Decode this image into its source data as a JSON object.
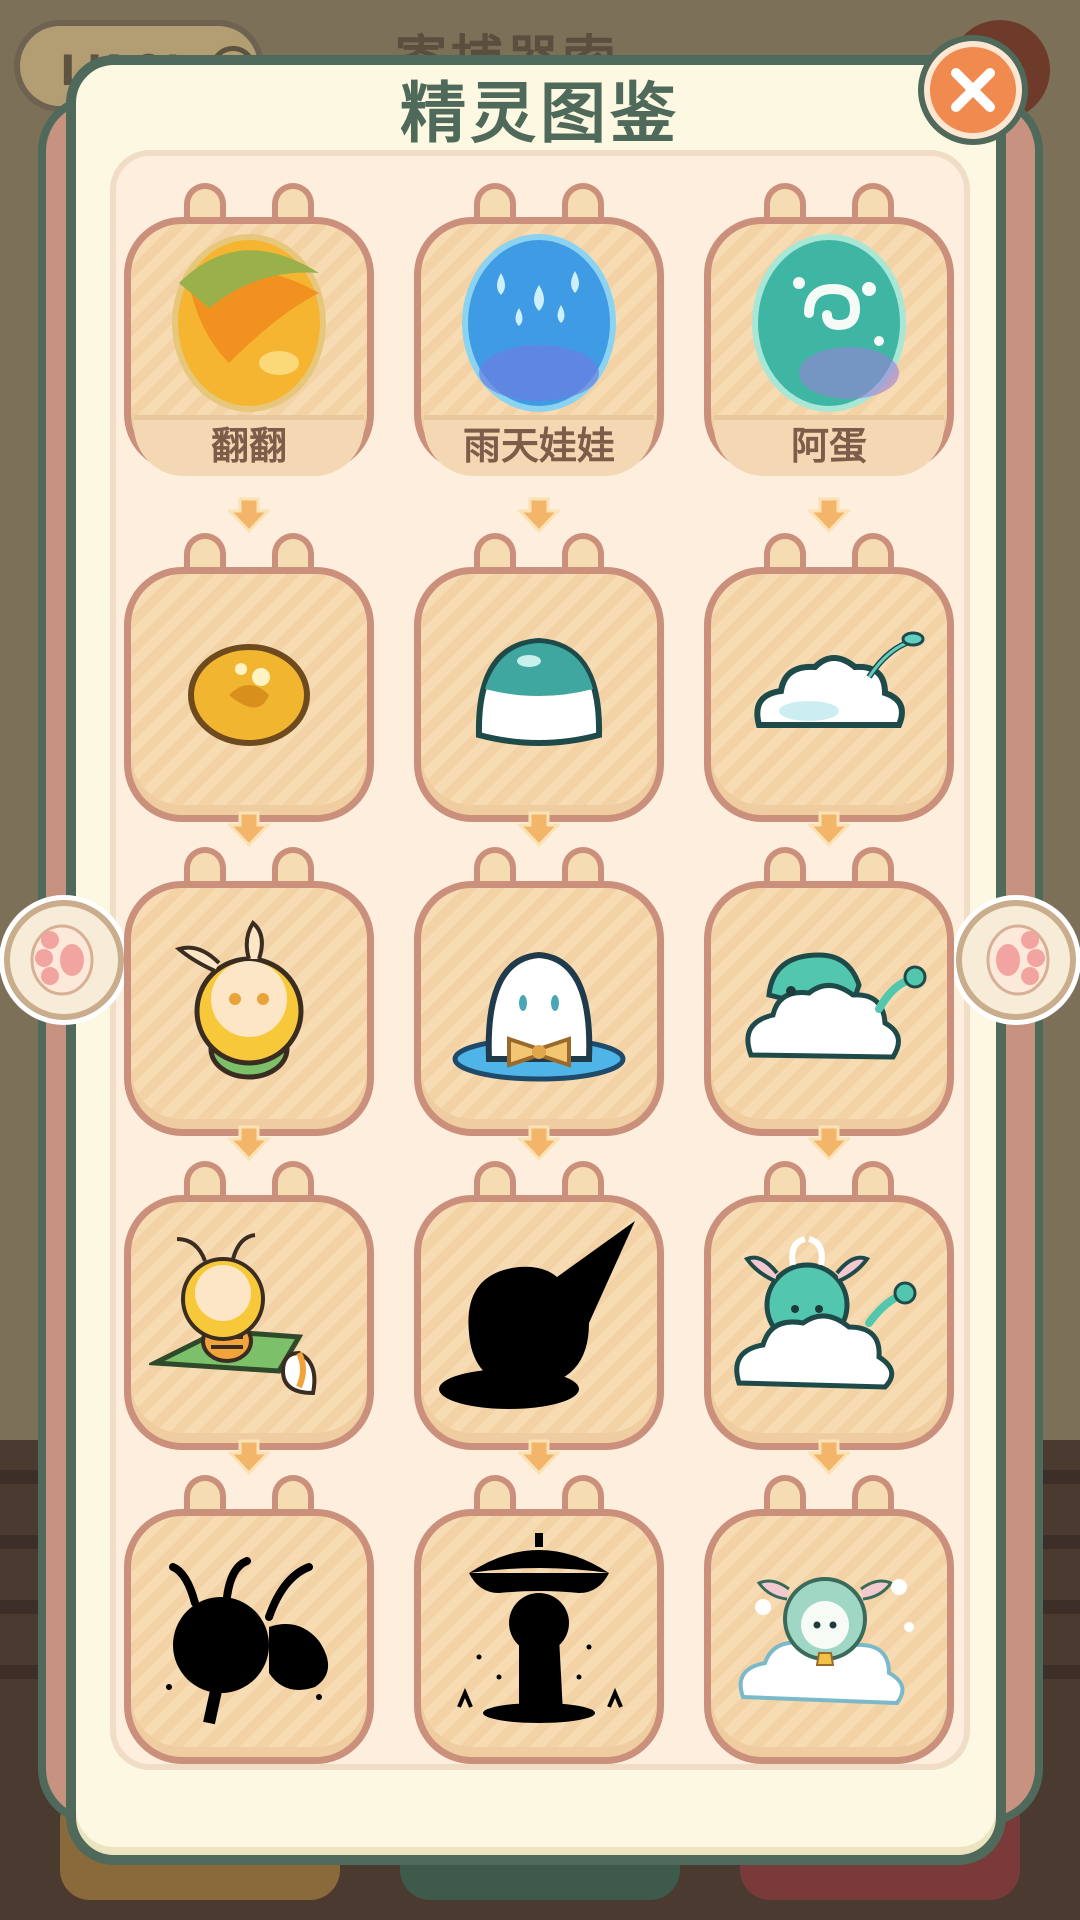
{
  "background": {
    "level_pill_text": "LK 0!",
    "title_text": "寄捕器索"
  },
  "panel": {
    "title": "精灵图鉴"
  },
  "colors": {
    "panel_border": "#4f6a5a",
    "card_border": "#cb907b",
    "close_button": "#f08a4e"
  },
  "eggs": [
    {
      "label": "翻翻",
      "icon": "leaf-egg-icon"
    },
    {
      "label": "雨天娃娃",
      "icon": "raindrop-egg-icon"
    },
    {
      "label": "阿蛋",
      "icon": "swirl-egg-icon"
    }
  ],
  "spirits": [
    {
      "icon": "golden-seed-icon",
      "locked": false
    },
    {
      "icon": "jelly-dome-icon",
      "locked": false
    },
    {
      "icon": "cloud-sprout-icon",
      "locked": false
    },
    {
      "icon": "fluffy-sprout-icon",
      "locked": false
    },
    {
      "icon": "ghost-bowtie-icon",
      "locked": false
    },
    {
      "icon": "cloud-bird-icon",
      "locked": false
    },
    {
      "icon": "bee-on-leaf-icon",
      "locked": false
    },
    {
      "icon": "witch-hat-silhouette-icon",
      "locked": true
    },
    {
      "icon": "cloud-goat-icon",
      "locked": false
    },
    {
      "icon": "bug-silhouette-icon",
      "locked": true
    },
    {
      "icon": "umbrella-figure-silhouette-icon",
      "locked": true
    },
    {
      "icon": "cloud-goat-bell-icon",
      "locked": false
    }
  ]
}
